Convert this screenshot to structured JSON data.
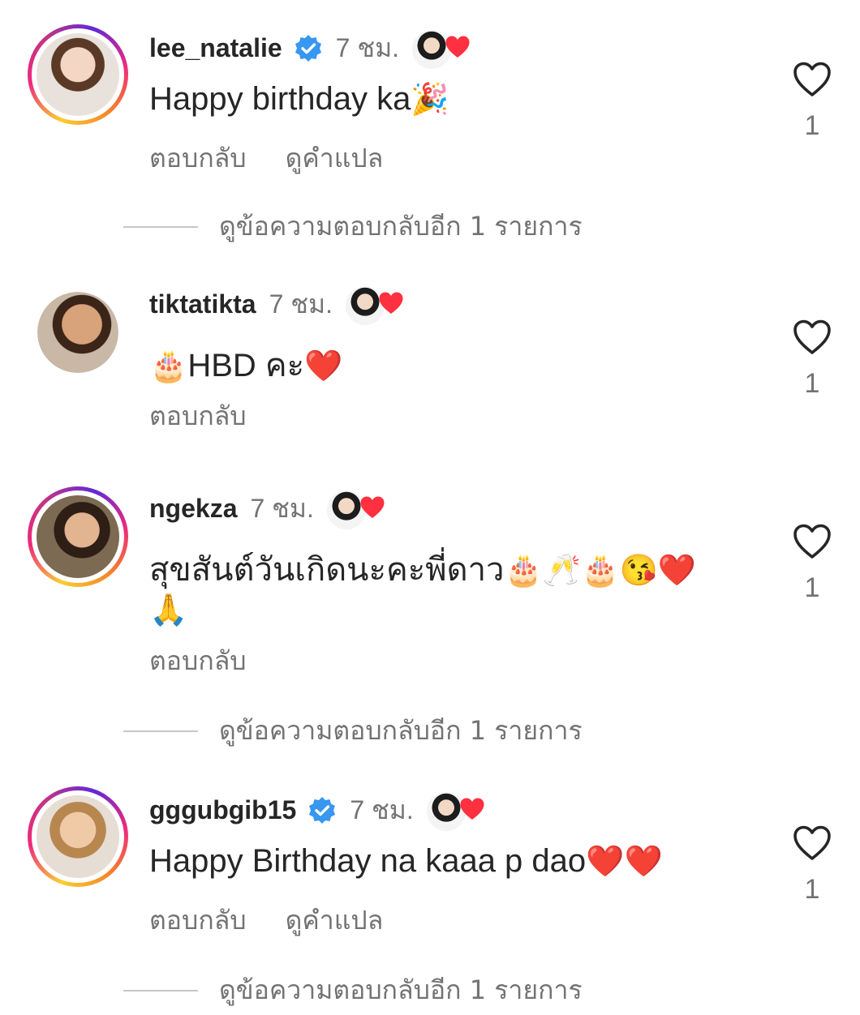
{
  "comments": [
    {
      "username": "lee_natalie",
      "verified": true,
      "time": "7 ชม.",
      "text": "Happy birthday ka",
      "text_emoji": "🎉",
      "actions": [
        "ตอบกลับ",
        "ดูคำแปล"
      ],
      "like_count": "1",
      "view_replies": "ดูข้อความตอบกลับอีก 1 รายการ",
      "story_ring": true
    },
    {
      "username": "tiktatikta",
      "verified": false,
      "time": "7 ชม.",
      "text_emoji_lead": "🎂",
      "text": "HBD คะ",
      "text_emoji": "❤️",
      "actions": [
        "ตอบกลับ"
      ],
      "like_count": "1",
      "story_ring": false
    },
    {
      "username": "ngekza",
      "verified": false,
      "time": "7 ชม.",
      "text": "สุขสันต์วันเกิดนะคะพี่ดาว",
      "text_emoji": "🎂🥂🎂😘❤️",
      "text_line2": "🙏",
      "actions": [
        "ตอบกลับ"
      ],
      "like_count": "1",
      "view_replies": "ดูข้อความตอบกลับอีก 1 รายการ",
      "story_ring": true
    },
    {
      "username": "gggubgib15",
      "verified": true,
      "time": "7 ชม.",
      "text": "Happy Birthday na kaaa p dao",
      "text_emoji": "❤️❤️",
      "actions": [
        "ตอบกลับ",
        "ดูคำแปล"
      ],
      "like_count": "1",
      "view_replies": "ดูข้อความตอบกลับอีก 1 รายการ",
      "story_ring": true
    }
  ],
  "colors": {
    "text_primary": "#262626",
    "text_secondary": "#737373",
    "verified_blue": "#3897f0",
    "heart_red": "#ff3040",
    "divider": "#c7c7c7"
  },
  "icons": {
    "verified": "verified-badge-icon",
    "like": "heart-outline-icon",
    "liked_by_author": "red-heart-icon"
  }
}
